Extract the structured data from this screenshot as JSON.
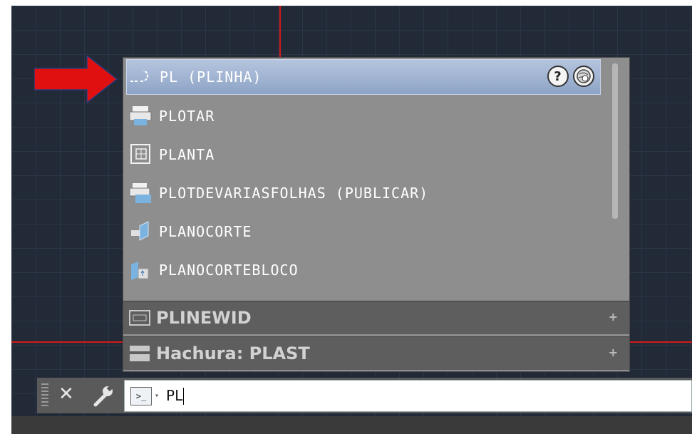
{
  "popup": {
    "items": [
      {
        "label": "PL (PLINHA)",
        "icon": "polyline-icon",
        "selected": true
      },
      {
        "label": "PLOTAR",
        "icon": "printer-icon"
      },
      {
        "label": "PLANTA",
        "icon": "layout-icon"
      },
      {
        "label": "PLOTDEVARIASFOLHAS (PUBLICAR)",
        "icon": "publish-icon"
      },
      {
        "label": "PLANOCORTE",
        "icon": "section-plane-icon"
      },
      {
        "label": "PLANOCORTEBLOCO",
        "icon": "section-plane-block-icon"
      }
    ],
    "help_label": "?",
    "sections": [
      {
        "label": "PLINEWID",
        "icon": "system-variable-icon",
        "expand": "+"
      },
      {
        "label": "Hachura: PLAST",
        "icon": "hatch-icon",
        "expand": "+"
      }
    ]
  },
  "command_line": {
    "close_label": "✕",
    "prompt_icon_label": ">_",
    "dropdown_label": "▾",
    "value": "PL"
  },
  "colors": {
    "arrow": "#e01010",
    "selection": "#9fb3d4",
    "canvas": "#222a38",
    "crosshair": "#d11a1a"
  }
}
